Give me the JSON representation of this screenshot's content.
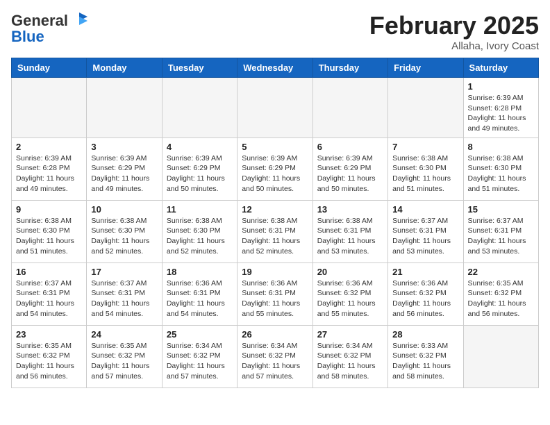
{
  "logo": {
    "general": "General",
    "blue": "Blue"
  },
  "header": {
    "month": "February 2025",
    "location": "Allaha, Ivory Coast"
  },
  "days_of_week": [
    "Sunday",
    "Monday",
    "Tuesday",
    "Wednesday",
    "Thursday",
    "Friday",
    "Saturday"
  ],
  "weeks": [
    [
      {
        "day": "",
        "info": ""
      },
      {
        "day": "",
        "info": ""
      },
      {
        "day": "",
        "info": ""
      },
      {
        "day": "",
        "info": ""
      },
      {
        "day": "",
        "info": ""
      },
      {
        "day": "",
        "info": ""
      },
      {
        "day": "1",
        "info": "Sunrise: 6:39 AM\nSunset: 6:28 PM\nDaylight: 11 hours\nand 49 minutes."
      }
    ],
    [
      {
        "day": "2",
        "info": "Sunrise: 6:39 AM\nSunset: 6:28 PM\nDaylight: 11 hours\nand 49 minutes."
      },
      {
        "day": "3",
        "info": "Sunrise: 6:39 AM\nSunset: 6:29 PM\nDaylight: 11 hours\nand 49 minutes."
      },
      {
        "day": "4",
        "info": "Sunrise: 6:39 AM\nSunset: 6:29 PM\nDaylight: 11 hours\nand 50 minutes."
      },
      {
        "day": "5",
        "info": "Sunrise: 6:39 AM\nSunset: 6:29 PM\nDaylight: 11 hours\nand 50 minutes."
      },
      {
        "day": "6",
        "info": "Sunrise: 6:39 AM\nSunset: 6:29 PM\nDaylight: 11 hours\nand 50 minutes."
      },
      {
        "day": "7",
        "info": "Sunrise: 6:38 AM\nSunset: 6:30 PM\nDaylight: 11 hours\nand 51 minutes."
      },
      {
        "day": "8",
        "info": "Sunrise: 6:38 AM\nSunset: 6:30 PM\nDaylight: 11 hours\nand 51 minutes."
      }
    ],
    [
      {
        "day": "9",
        "info": "Sunrise: 6:38 AM\nSunset: 6:30 PM\nDaylight: 11 hours\nand 51 minutes."
      },
      {
        "day": "10",
        "info": "Sunrise: 6:38 AM\nSunset: 6:30 PM\nDaylight: 11 hours\nand 52 minutes."
      },
      {
        "day": "11",
        "info": "Sunrise: 6:38 AM\nSunset: 6:30 PM\nDaylight: 11 hours\nand 52 minutes."
      },
      {
        "day": "12",
        "info": "Sunrise: 6:38 AM\nSunset: 6:31 PM\nDaylight: 11 hours\nand 52 minutes."
      },
      {
        "day": "13",
        "info": "Sunrise: 6:38 AM\nSunset: 6:31 PM\nDaylight: 11 hours\nand 53 minutes."
      },
      {
        "day": "14",
        "info": "Sunrise: 6:37 AM\nSunset: 6:31 PM\nDaylight: 11 hours\nand 53 minutes."
      },
      {
        "day": "15",
        "info": "Sunrise: 6:37 AM\nSunset: 6:31 PM\nDaylight: 11 hours\nand 53 minutes."
      }
    ],
    [
      {
        "day": "16",
        "info": "Sunrise: 6:37 AM\nSunset: 6:31 PM\nDaylight: 11 hours\nand 54 minutes."
      },
      {
        "day": "17",
        "info": "Sunrise: 6:37 AM\nSunset: 6:31 PM\nDaylight: 11 hours\nand 54 minutes."
      },
      {
        "day": "18",
        "info": "Sunrise: 6:36 AM\nSunset: 6:31 PM\nDaylight: 11 hours\nand 54 minutes."
      },
      {
        "day": "19",
        "info": "Sunrise: 6:36 AM\nSunset: 6:31 PM\nDaylight: 11 hours\nand 55 minutes."
      },
      {
        "day": "20",
        "info": "Sunrise: 6:36 AM\nSunset: 6:32 PM\nDaylight: 11 hours\nand 55 minutes."
      },
      {
        "day": "21",
        "info": "Sunrise: 6:36 AM\nSunset: 6:32 PM\nDaylight: 11 hours\nand 56 minutes."
      },
      {
        "day": "22",
        "info": "Sunrise: 6:35 AM\nSunset: 6:32 PM\nDaylight: 11 hours\nand 56 minutes."
      }
    ],
    [
      {
        "day": "23",
        "info": "Sunrise: 6:35 AM\nSunset: 6:32 PM\nDaylight: 11 hours\nand 56 minutes."
      },
      {
        "day": "24",
        "info": "Sunrise: 6:35 AM\nSunset: 6:32 PM\nDaylight: 11 hours\nand 57 minutes."
      },
      {
        "day": "25",
        "info": "Sunrise: 6:34 AM\nSunset: 6:32 PM\nDaylight: 11 hours\nand 57 minutes."
      },
      {
        "day": "26",
        "info": "Sunrise: 6:34 AM\nSunset: 6:32 PM\nDaylight: 11 hours\nand 57 minutes."
      },
      {
        "day": "27",
        "info": "Sunrise: 6:34 AM\nSunset: 6:32 PM\nDaylight: 11 hours\nand 58 minutes."
      },
      {
        "day": "28",
        "info": "Sunrise: 6:33 AM\nSunset: 6:32 PM\nDaylight: 11 hours\nand 58 minutes."
      },
      {
        "day": "",
        "info": ""
      }
    ]
  ]
}
